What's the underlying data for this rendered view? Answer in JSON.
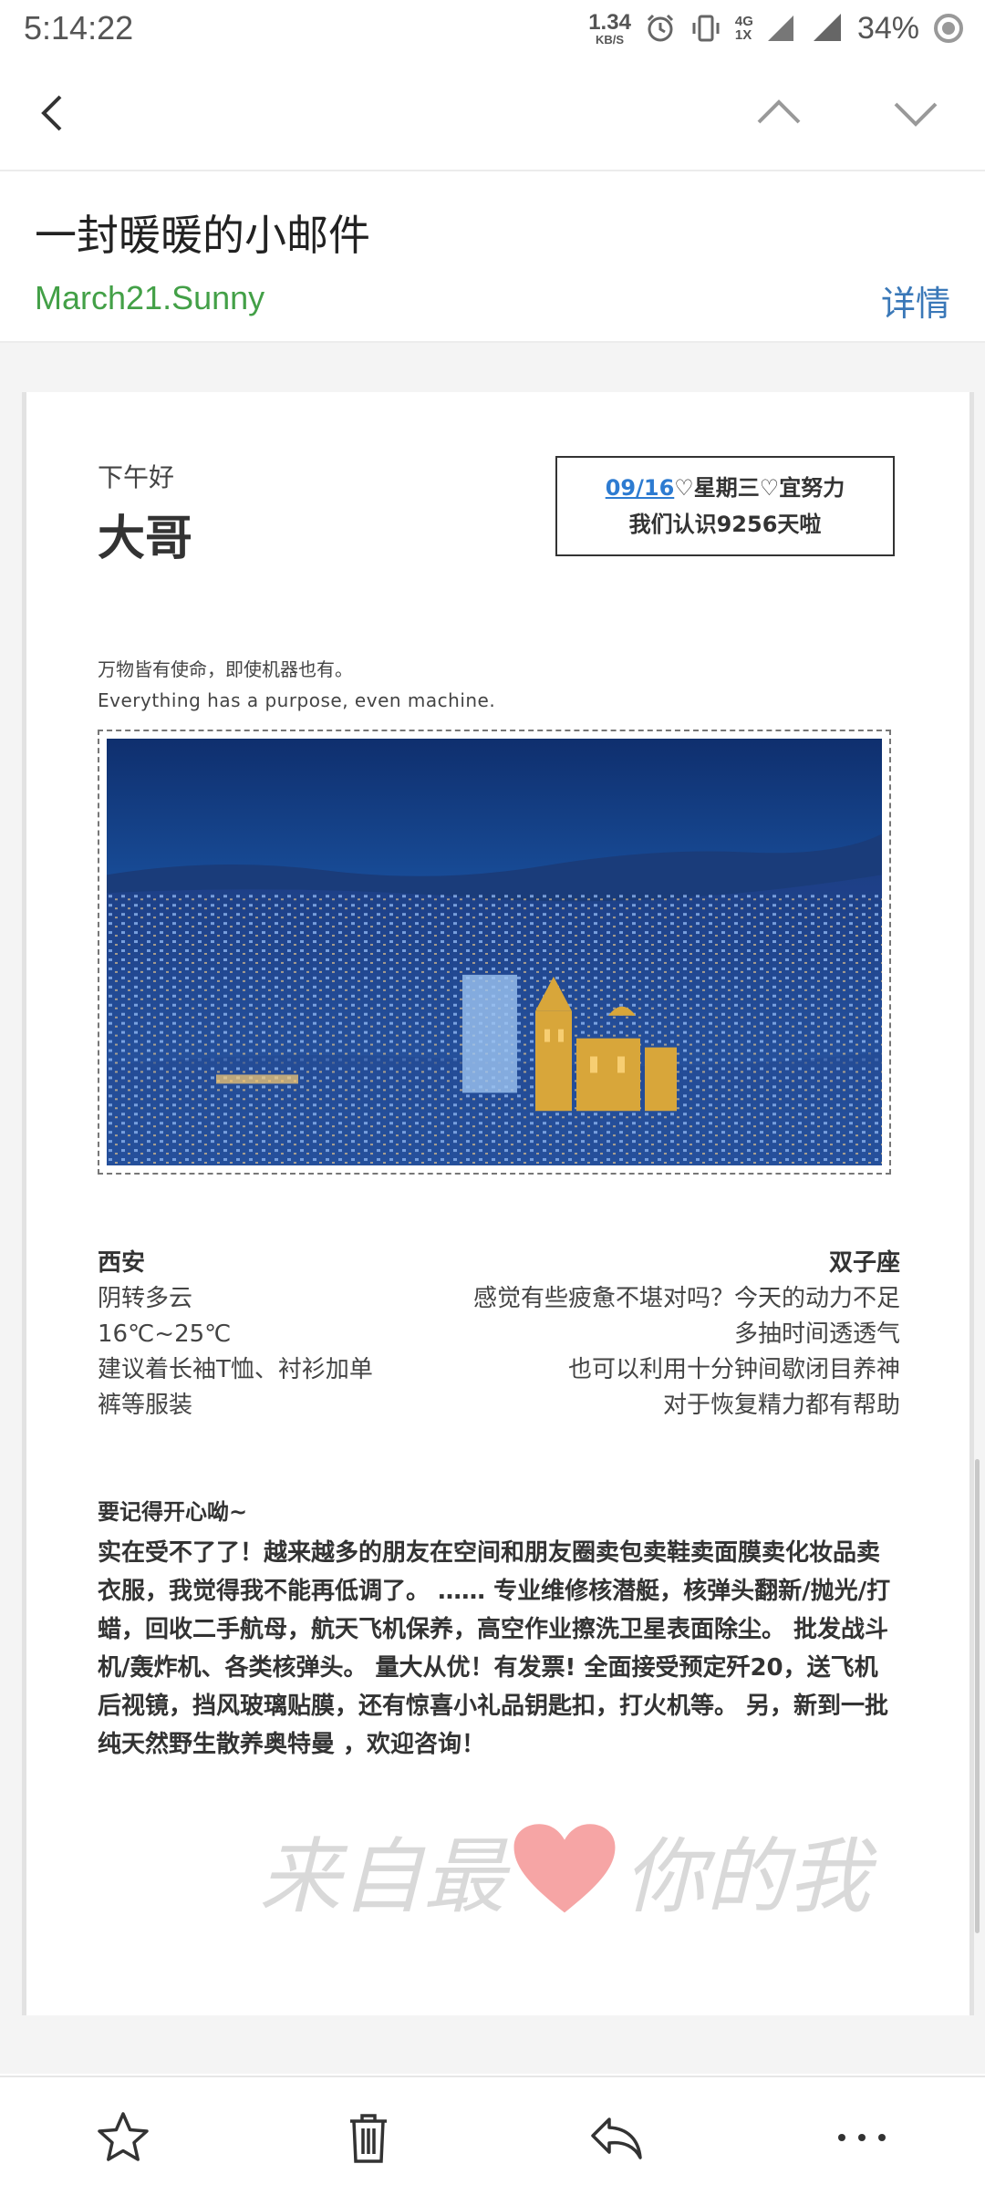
{
  "status_bar": {
    "time": "5:14:22",
    "net_speed": "1.34",
    "net_speed_unit": "KB/S",
    "net_type_top": "4G",
    "net_type_bottom": "1X",
    "battery": "34%"
  },
  "toolbar": {
    "back_icon": "back-arrow-icon",
    "prev_icon": "chevron-up-icon",
    "next_icon": "chevron-down-icon"
  },
  "header": {
    "subject": "一封暖暖的小邮件",
    "sender": "March21.Sunny",
    "details_label": "详情"
  },
  "mail": {
    "greeting": "下午好",
    "name": "大哥",
    "date": "09/16",
    "date_suffix": "♡星期三♡宜努力",
    "days_known": "我们认识9256天啦",
    "quote_cn": "万物皆有使命，即使机器也有。",
    "quote_en": "Everything has a purpose, even machine.",
    "weather": {
      "city": "西安",
      "condition": "阴转多云",
      "temp": "16℃~25℃",
      "advice_1": "建议着长袖T恤、衬衫加单",
      "advice_2": "裤等服装"
    },
    "horoscope": {
      "sign": "双子座",
      "line_1": "感觉有些疲惫不堪对吗？今天的动力不足",
      "line_2": "多抽时间透透气",
      "line_3": "也可以利用十分钟间歇闭目养神",
      "line_4": "对于恢复精力都有帮助"
    },
    "remember": "要记得开心呦~",
    "ad_text": "实在受不了了！越来越多的朋友在空间和朋友圈卖包卖鞋卖面膜卖化妆品卖衣服，我觉得我不能再低调了。 …… 专业维修核潜艇，核弹头翻新/抛光/打蜡，回收二手航母，航天飞机保养，高空作业擦洗卫星表面除尘。 批发战斗机/轰炸机、各类核弹头。 量大从优！有发票! 全面接受预定歼20，送飞机后视镜，挡风玻璃贴膜，还有惊喜小礼品钥匙扣，打火机等。 另，新到一批纯天然野生散养奥特曼 ，欢迎咨询！",
    "signature_left": "来自最",
    "signature_right": "你的我"
  },
  "bottom_bar": {
    "star_icon": "star-icon",
    "trash_icon": "trash-icon",
    "reply_icon": "reply-icon",
    "more_icon": "more-icon"
  },
  "colors": {
    "sender_green": "#43a047",
    "link_blue": "#3a78b8",
    "date_blue": "#2d7bd1",
    "heart_pink": "#f6a5a5"
  }
}
